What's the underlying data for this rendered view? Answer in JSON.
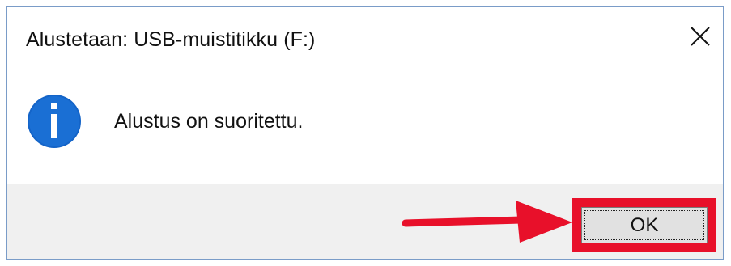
{
  "dialog": {
    "title": "Alustetaan: USB-muistitikku (F:)",
    "message": "Alustus on suoritettu.",
    "icon": "info-icon",
    "ok_label": "OK"
  },
  "colors": {
    "info_blue": "#1464c8",
    "highlight_red": "#e8102a",
    "footer_bg": "#f0f0f0",
    "button_bg": "#e1e1e1"
  }
}
